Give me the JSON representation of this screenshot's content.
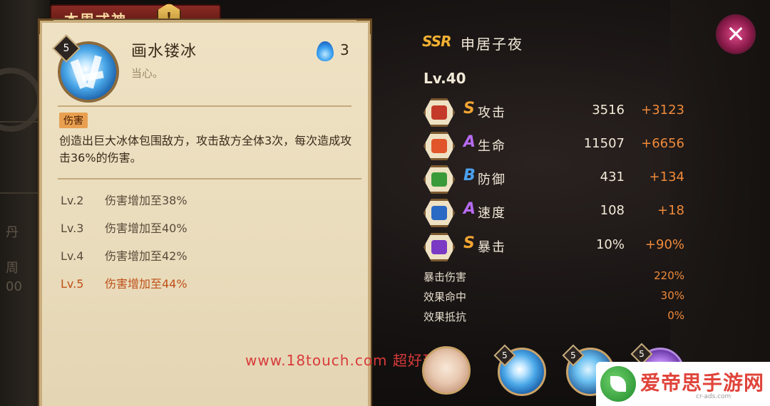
{
  "title_tab": "本周式神",
  "title_badge": "!",
  "left_bg_text": [
    "丹",
    "周",
    "00"
  ],
  "skill": {
    "level": "5",
    "name": "画水镂冰",
    "subtitle": "当心。",
    "cost": "3",
    "tag": "伤害",
    "description": "创造出巨大冰体包围敌方，攻击敌方全体3次，每次造成攻击36%的伤害。",
    "upgrades": [
      {
        "level": "Lv.2",
        "text": "伤害增加至38%",
        "active": false
      },
      {
        "level": "Lv.3",
        "text": "伤害增加至40%",
        "active": false
      },
      {
        "level": "Lv.4",
        "text": "伤害增加至42%",
        "active": false
      },
      {
        "level": "Lv.5",
        "text": "伤害增加至44%",
        "active": true
      }
    ]
  },
  "character": {
    "rarity": "SSR",
    "name": "申居子夜",
    "level": "Lv.40"
  },
  "stats": [
    {
      "grade": "S",
      "label": "攻击",
      "base": "3516",
      "bonus": "+3123",
      "icon": "fan-icon",
      "icon_color": "#c43a2a"
    },
    {
      "grade": "A",
      "label": "生命",
      "base": "11507",
      "bonus": "+6656",
      "icon": "talisman-icon",
      "icon_color": "#e0562a"
    },
    {
      "grade": "B",
      "label": "防御",
      "base": "431",
      "bonus": "+134",
      "icon": "armor-icon",
      "icon_color": "#3a9a3a"
    },
    {
      "grade": "A",
      "label": "速度",
      "base": "108",
      "bonus": "+18",
      "icon": "chevron-speed-icon",
      "icon_color": "#2a6ac4"
    },
    {
      "grade": "S",
      "label": "暴击",
      "base": "10%",
      "bonus": "+90%",
      "icon": "crit-scroll-icon",
      "icon_color": "#7a3ac4"
    }
  ],
  "sub_stats": [
    {
      "label": "暴击伤害",
      "value": "220%"
    },
    {
      "label": "效果命中",
      "value": "30%"
    },
    {
      "label": "效果抵抗",
      "value": "0%"
    }
  ],
  "bottom": {
    "watermark": "www.18touch.com 超好玩攻略",
    "skill_levels": [
      "5",
      "5",
      "5",
      "5"
    ]
  },
  "brand": {
    "name": "爱帝思手游网",
    "url": "cr-ads.com"
  },
  "close_label": "✕",
  "colors": {
    "accent_orange": "#f08a3a",
    "grade_s": "#f2a532",
    "grade_a": "#b66af0",
    "grade_b": "#4aa0f0",
    "active_level": "#c0501a"
  }
}
